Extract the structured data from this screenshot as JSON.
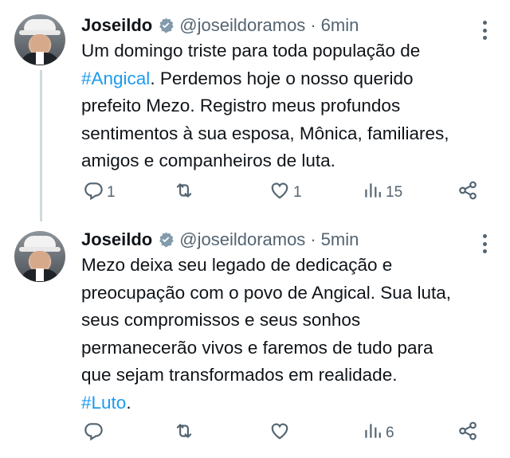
{
  "tweets": [
    {
      "name": "Joseildo",
      "handle": "@joseildoramos",
      "dot": "·",
      "time": "6min",
      "text_lines": [
        "Um domingo triste para toda população de",
        [
          {
            "hashtag": "#Angical"
          },
          ". Perdemos hoje o nosso querido"
        ],
        "prefeito Mezo. Registro meus profundos",
        "sentimentos à sua esposa, Mônica, familiares,",
        "amigos e companheiros de luta."
      ],
      "text_plain": {
        "l1": "Um domingo triste para toda população de",
        "l2_tag": "#Angical",
        "l2_rest": ". Perdemos hoje o nosso querido",
        "l3": "prefeito Mezo. Registro meus profundos",
        "l4": "sentimentos à sua esposa, Mônica, familiares,",
        "l5": "amigos e companheiros de luta."
      },
      "replies": "1",
      "retweets": "",
      "likes": "1",
      "views": "15"
    },
    {
      "name": "Joseildo",
      "handle": "@joseildoramos",
      "dot": "·",
      "time": "5min",
      "text_plain": {
        "l1": "Mezo deixa seu legado de dedicação e",
        "l2": "preocupação com o povo de Angical. Sua luta,",
        "l3": "seus compromissos e seus sonhos",
        "l4": "permanecerão vivos e faremos de tudo para",
        "l5": "que sejam transformados em realidade.",
        "l6_tag": "#Luto",
        "l6_rest": "."
      },
      "replies": "",
      "retweets": "",
      "likes": "",
      "views": "6"
    }
  ],
  "icons": {
    "verified": "verified-badge-icon",
    "reply": "reply-icon",
    "retweet": "retweet-icon",
    "like": "heart-icon",
    "views": "views-icon",
    "share": "share-icon",
    "more": "more-icon"
  },
  "colors": {
    "hashtag": "#1d9bf0",
    "muted": "#536471",
    "text": "#0f1419",
    "thread_line": "#cfd9de"
  }
}
